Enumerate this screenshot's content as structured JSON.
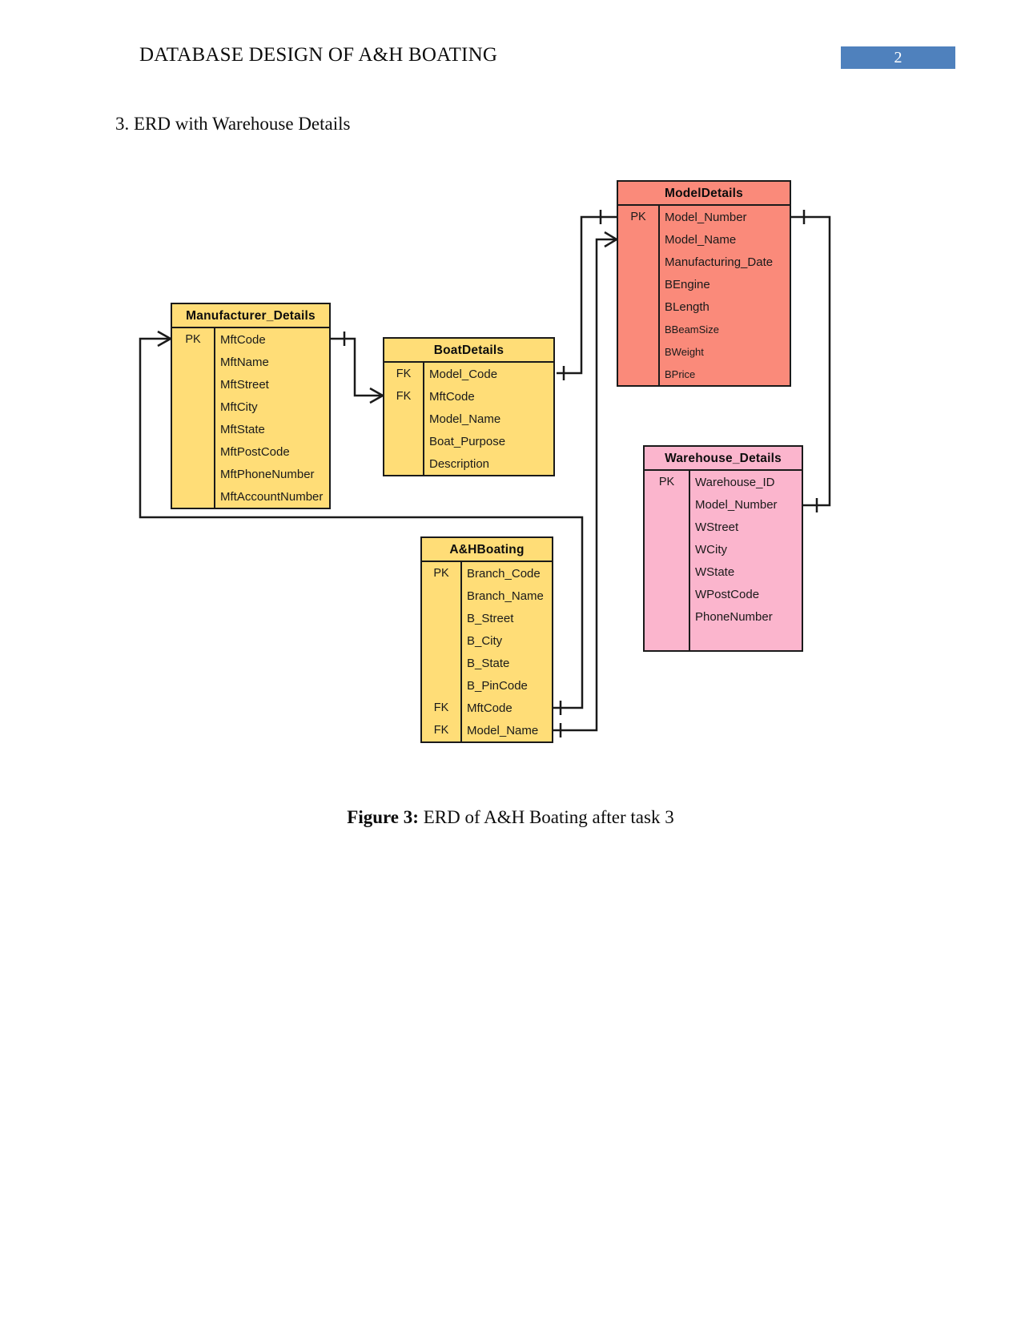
{
  "header": {
    "title": "DATABASE DESIGN OF A&H BOATING",
    "page_number": "2",
    "badge_color": "#4f81bd"
  },
  "section": {
    "heading": "3. ERD with Warehouse Details"
  },
  "figure": {
    "caption_label": "Figure 3:",
    "caption_text": " ERD of A&H Boating after task 3"
  },
  "diagram": {
    "type": "erd",
    "entities": [
      {
        "id": "manufacturer",
        "name": "Manufacturer_Details",
        "color": "#ffdd77",
        "attributes": [
          {
            "key": "PK",
            "name": "MftCode"
          },
          {
            "key": "",
            "name": "MftName"
          },
          {
            "key": "",
            "name": "MftStreet"
          },
          {
            "key": "",
            "name": "MftCity"
          },
          {
            "key": "",
            "name": "MftState"
          },
          {
            "key": "",
            "name": "MftPostCode"
          },
          {
            "key": "",
            "name": "MftPhoneNumber"
          },
          {
            "key": "",
            "name": "MftAccountNumber"
          }
        ]
      },
      {
        "id": "boat",
        "name": "BoatDetails",
        "color": "#ffdd77",
        "attributes": [
          {
            "key": "FK",
            "name": "Model_Code"
          },
          {
            "key": "FK",
            "name": "MftCode"
          },
          {
            "key": "",
            "name": "Model_Name"
          },
          {
            "key": "",
            "name": "Boat_Purpose"
          },
          {
            "key": "",
            "name": "Description"
          }
        ]
      },
      {
        "id": "model",
        "name": "ModelDetails",
        "color": "#fa8a7a",
        "attributes": [
          {
            "key": "PK",
            "name": "Model_Number"
          },
          {
            "key": "",
            "name": "Model_Name"
          },
          {
            "key": "",
            "name": "Manufacturing_Date"
          },
          {
            "key": "",
            "name": "BEngine"
          },
          {
            "key": "",
            "name": "BLength"
          },
          {
            "key": "",
            "name": "BBeamSize"
          },
          {
            "key": "",
            "name": "BWeight"
          },
          {
            "key": "",
            "name": "BPrice"
          }
        ]
      },
      {
        "id": "warehouse",
        "name": "Warehouse_Details",
        "color": "#fbb5cd",
        "attributes": [
          {
            "key": "PK",
            "name": "Warehouse_ID"
          },
          {
            "key": "",
            "name": "Model_Number"
          },
          {
            "key": "",
            "name": "WStreet"
          },
          {
            "key": "",
            "name": "WCity"
          },
          {
            "key": "",
            "name": "WState"
          },
          {
            "key": "",
            "name": "WPostCode"
          },
          {
            "key": "",
            "name": "PhoneNumber"
          }
        ]
      },
      {
        "id": "ahboating",
        "name": "A&HBoating",
        "color": "#ffdd77",
        "attributes": [
          {
            "key": "PK",
            "name": "Branch_Code"
          },
          {
            "key": "",
            "name": "Branch_Name"
          },
          {
            "key": "",
            "name": "B_Street"
          },
          {
            "key": "",
            "name": "B_City"
          },
          {
            "key": "",
            "name": "B_State"
          },
          {
            "key": "",
            "name": "B_PinCode"
          },
          {
            "key": "FK",
            "name": "MftCode"
          },
          {
            "key": "FK",
            "name": "Model_Name"
          }
        ]
      }
    ],
    "relationships": [
      {
        "from": "model",
        "to": "boat",
        "from_card": "one",
        "to_card": "many"
      },
      {
        "from": "manufacturer",
        "to": "boat",
        "from_card": "many",
        "to_card": "one"
      },
      {
        "from": "model",
        "to": "warehouse",
        "from_card": "one",
        "to_card": "one"
      },
      {
        "from": "manufacturer",
        "to": "ahboating",
        "from_card": "many",
        "to_card": "one"
      },
      {
        "from": "model",
        "to": "ahboating",
        "from_card": "one",
        "to_card": "one"
      }
    ]
  }
}
